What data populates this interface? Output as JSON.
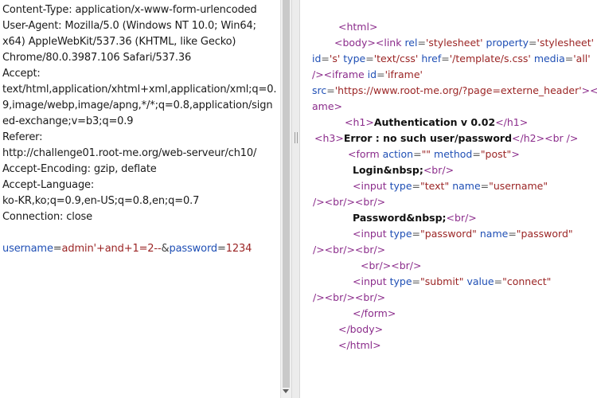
{
  "request": {
    "lines": [
      "Content-Type: application/x-www-form-urlencoded",
      "User-Agent: Mozilla/5.0 (Windows NT 10.0; Win64;",
      "x64) AppleWebKit/537.36 (KHTML, like Gecko)",
      "Chrome/80.0.3987.106 Safari/537.36",
      "Accept:",
      "text/html,application/xhtml+xml,application/xml;q=0.",
      "9,image/webp,image/apng,*/*;q=0.8,application/sign",
      "ed-exchange;v=b3;q=0.9",
      "Referer:",
      "http://challenge01.root-me.org/web-serveur/ch10/",
      "Accept-Encoding: gzip, deflate",
      "Accept-Language:",
      "ko-KR,ko;q=0.9,en-US;q=0.8,en;q=0.7",
      "Connection: close"
    ],
    "body_params": {
      "username_key": "username",
      "eq1": "=",
      "username_value": "admin'+and+1=2--",
      "amp": "&",
      "password_key": "password",
      "eq2": "=",
      "password_value": "1234"
    }
  },
  "response": {
    "lines": [
      [
        {
          "t": "tag",
          "s": "<html>"
        }
      ],
      [
        {
          "t": "tag",
          "s": "<body>"
        },
        {
          "t": "tag",
          "s": "<link "
        },
        {
          "t": "attr",
          "s": "rel"
        },
        {
          "t": "plain",
          "s": "="
        },
        {
          "t": "val",
          "s": "'stylesheet'"
        },
        {
          "t": "plain",
          "s": " "
        },
        {
          "t": "attr",
          "s": "property"
        },
        {
          "t": "plain",
          "s": "="
        },
        {
          "t": "val",
          "s": "'stylesheet'"
        }
      ],
      [
        {
          "t": "attr",
          "s": "id"
        },
        {
          "t": "plain",
          "s": "="
        },
        {
          "t": "val",
          "s": "'s'"
        },
        {
          "t": "plain",
          "s": " "
        },
        {
          "t": "attr",
          "s": "type"
        },
        {
          "t": "plain",
          "s": "="
        },
        {
          "t": "val",
          "s": "'text/css'"
        },
        {
          "t": "plain",
          "s": " "
        },
        {
          "t": "attr",
          "s": "href"
        },
        {
          "t": "plain",
          "s": "="
        },
        {
          "t": "val",
          "s": "'/template/s.css'"
        },
        {
          "t": "plain",
          "s": " "
        },
        {
          "t": "attr",
          "s": "media"
        },
        {
          "t": "plain",
          "s": "="
        },
        {
          "t": "val",
          "s": "'all'"
        }
      ],
      [
        {
          "t": "tag",
          "s": "/><iframe "
        },
        {
          "t": "attr",
          "s": "id"
        },
        {
          "t": "plain",
          "s": "="
        },
        {
          "t": "val",
          "s": "'iframe'"
        }
      ],
      [
        {
          "t": "attr",
          "s": "src"
        },
        {
          "t": "plain",
          "s": "="
        },
        {
          "t": "val",
          "s": "'https://www.root-me.org/?page=externe_header'"
        },
        {
          "t": "tag",
          "s": "></if"
        }
      ],
      [
        {
          "t": "tag",
          "s": "ame>"
        }
      ],
      [
        {
          "t": "tag",
          "s": "<h1>"
        },
        {
          "t": "txt",
          "s": "Authentication v 0.02"
        },
        {
          "t": "tag",
          "s": "</h1>"
        }
      ],
      [
        {
          "t": "tag",
          "s": "<h3>"
        },
        {
          "t": "txt",
          "s": "Error : no such user/password"
        },
        {
          "t": "tag",
          "s": "</h2>"
        },
        {
          "t": "tag",
          "s": "<br />"
        }
      ],
      [
        {
          "t": "tag",
          "s": "<form "
        },
        {
          "t": "attr",
          "s": "action"
        },
        {
          "t": "plain",
          "s": "="
        },
        {
          "t": "val",
          "s": "\"\""
        },
        {
          "t": "plain",
          "s": " "
        },
        {
          "t": "attr",
          "s": "method"
        },
        {
          "t": "plain",
          "s": "="
        },
        {
          "t": "val",
          "s": "\"post\""
        },
        {
          "t": "tag",
          "s": ">"
        }
      ],
      [
        {
          "t": "txt",
          "s": "Login&nbsp;"
        },
        {
          "t": "tag",
          "s": "<br/>"
        }
      ],
      [
        {
          "t": "tag",
          "s": "<input "
        },
        {
          "t": "attr",
          "s": "type"
        },
        {
          "t": "plain",
          "s": "="
        },
        {
          "t": "val",
          "s": "\"text\""
        },
        {
          "t": "plain",
          "s": " "
        },
        {
          "t": "attr",
          "s": "name"
        },
        {
          "t": "plain",
          "s": "="
        },
        {
          "t": "val",
          "s": "\"username\""
        }
      ],
      [
        {
          "t": "tag",
          "s": "/><br/><br/>"
        }
      ],
      [
        {
          "t": "txt",
          "s": "Password&nbsp;"
        },
        {
          "t": "tag",
          "s": "<br/>"
        }
      ],
      [
        {
          "t": "tag",
          "s": "<input "
        },
        {
          "t": "attr",
          "s": "type"
        },
        {
          "t": "plain",
          "s": "="
        },
        {
          "t": "val",
          "s": "\"password\""
        },
        {
          "t": "plain",
          "s": " "
        },
        {
          "t": "attr",
          "s": "name"
        },
        {
          "t": "plain",
          "s": "="
        },
        {
          "t": "val",
          "s": "\"password\""
        }
      ],
      [
        {
          "t": "tag",
          "s": "/><br/><br/>"
        }
      ],
      [
        {
          "t": "tag",
          "s": "<br/><br/>"
        }
      ],
      [
        {
          "t": "tag",
          "s": "<input "
        },
        {
          "t": "attr",
          "s": "type"
        },
        {
          "t": "plain",
          "s": "="
        },
        {
          "t": "val",
          "s": "\"submit\""
        },
        {
          "t": "plain",
          "s": " "
        },
        {
          "t": "attr",
          "s": "value"
        },
        {
          "t": "plain",
          "s": "="
        },
        {
          "t": "val",
          "s": "\"connect\""
        }
      ],
      [
        {
          "t": "tag",
          "s": "/><br/><br/>"
        }
      ],
      [
        {
          "t": "tag",
          "s": "</form>"
        }
      ],
      [
        {
          "t": "tag",
          "s": "</body>"
        }
      ],
      [
        {
          "t": "tag",
          "s": "</html>"
        }
      ]
    ]
  },
  "colors": {
    "tag": "#8b2c8b",
    "attribute": "#1f4fb5",
    "value": "#9b2525"
  }
}
